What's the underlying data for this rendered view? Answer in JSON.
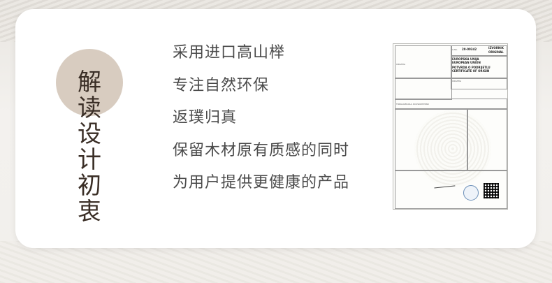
{
  "title": {
    "chars": [
      "解",
      "读",
      "设",
      "计",
      "初",
      "衷"
    ]
  },
  "features": [
    "采用进口高山榉",
    "专注自然环保",
    "返璞归真",
    "保留木材原有质感的同时",
    "为用户提供更健康的产品"
  ],
  "certificate": {
    "no_label": "A-No.",
    "no_value": "20-00342",
    "izvornik": "IZVORNIK",
    "original": "ORIGINAL",
    "union_lines": [
      "EUROPSKA UNIJA",
      "EUROPEAN UNION"
    ],
    "cert_lines": [
      "POTVRDA O PODRIJETLU",
      "CERTIFICATE OF ORIGIN"
    ],
    "country": "CROATIA",
    "consignee_country": "CROATIA",
    "transport_label": "TORGUAM-02A, ROVGUM-TRSD"
  }
}
